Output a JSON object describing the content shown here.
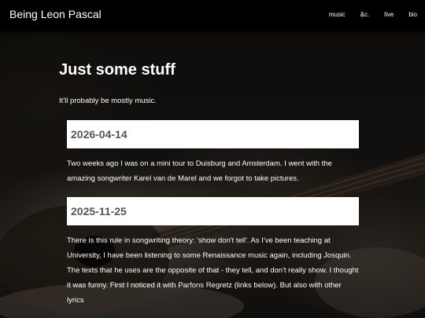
{
  "navbar": {
    "brand": "Being Leon Pascal",
    "links": [
      "music",
      "&c.",
      "live",
      "bio"
    ]
  },
  "main": {
    "title": "Just some stuff",
    "intro": "It'll probably be mostly music."
  },
  "posts": [
    {
      "date": "2026-04-14",
      "text": "Two weeks ago I was on a mini tour to Duisburg and Amsterdam. I went with the amazing songwriter Karel van de Marel and we forgot to take pictures."
    },
    {
      "date": "2025-11-25",
      "text": "There is this rule in songwriting theory: 'show don't tell'. As I've been teaching at University, I have been listening to some Renaissance music again, including Josquin. The texts that he uses are the opposite of that - they tell, and don't really show. I thought it was funny. First I noticed it with Parfons Regretz (links below). But also with other lyrics"
    }
  ]
}
